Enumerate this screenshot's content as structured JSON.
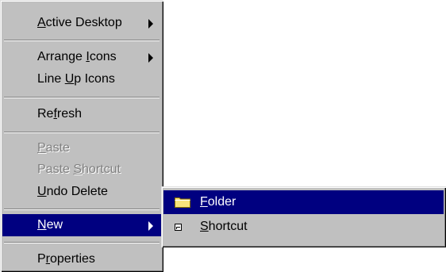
{
  "context_menu": {
    "items": [
      {
        "label": "Active Desktop",
        "accel": "A"
      },
      {
        "label": "Arrange Icons",
        "accel": "I"
      },
      {
        "label": "Line Up Icons",
        "accel": "U"
      },
      {
        "label": "Refresh",
        "accel": "f"
      },
      {
        "label": "Paste",
        "accel": "P"
      },
      {
        "label": "Paste Shortcut",
        "accel": "S"
      },
      {
        "label": "Undo Delete",
        "accel": "U"
      },
      {
        "label": "New",
        "accel": "N"
      },
      {
        "label": "Properties",
        "accel": "r"
      }
    ]
  },
  "new_submenu": {
    "items": [
      {
        "label": "Folder",
        "accel": "F",
        "icon": "folder-icon"
      },
      {
        "label": "Shortcut",
        "accel": "S",
        "icon": "shortcut-icon"
      }
    ]
  },
  "colors": {
    "menu_face": "#c0c0c0",
    "highlight": "#000080",
    "disabled_text": "#808080"
  }
}
